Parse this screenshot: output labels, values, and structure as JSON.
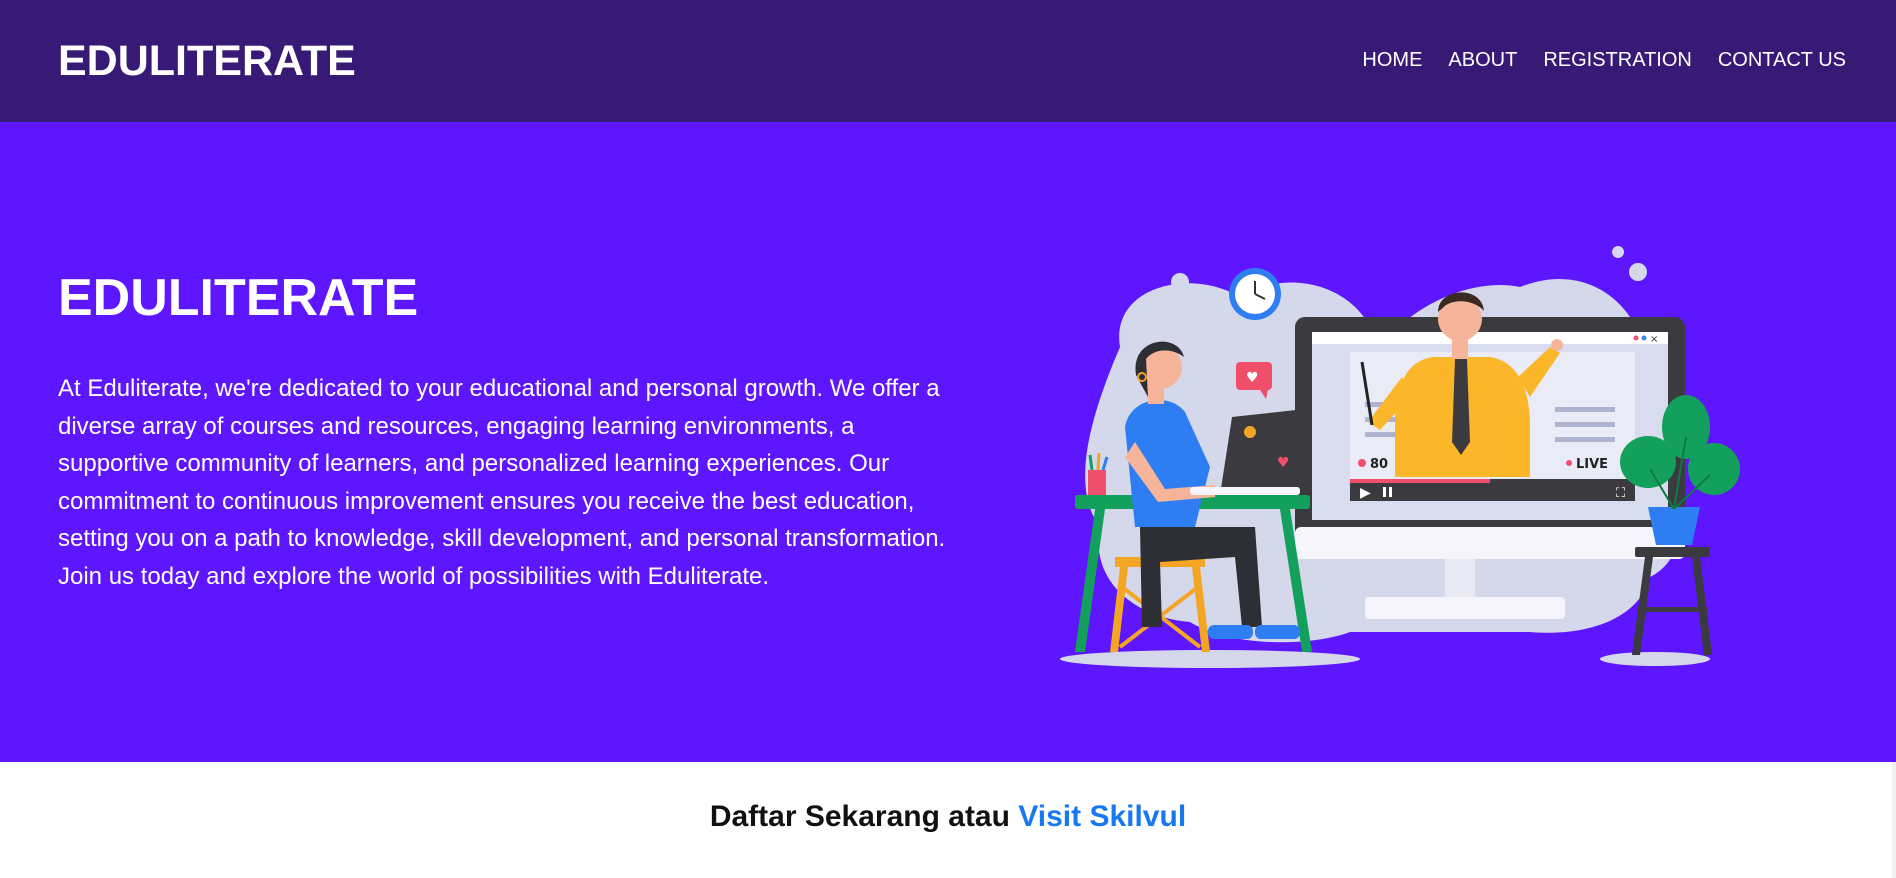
{
  "navbar": {
    "brand": "EDULITERATE",
    "links": [
      "HOME",
      "ABOUT",
      "REGISTRATION",
      "CONTACT US"
    ]
  },
  "hero": {
    "title": "EDULITERATE",
    "description": "At Eduliterate, we're dedicated to your educational and personal growth. We offer a diverse array of courses and resources, engaging learning environments, a supportive community of learners, and personalized learning experiences. Our commitment to continuous improvement ensures you receive the best education, setting you on a path to knowledge, skill development, and personal transformation. Join us today and explore the world of possibilities with Eduliterate.",
    "illustration": {
      "viewer_count": "80",
      "live_label": "LIVE"
    }
  },
  "cta": {
    "text": "Daftar Sekarang atau",
    "link_label": "Visit Skilvul"
  },
  "colors": {
    "navbar_bg": "#361a75",
    "hero_bg": "#5d16fd",
    "link_blue": "#1877f2"
  }
}
